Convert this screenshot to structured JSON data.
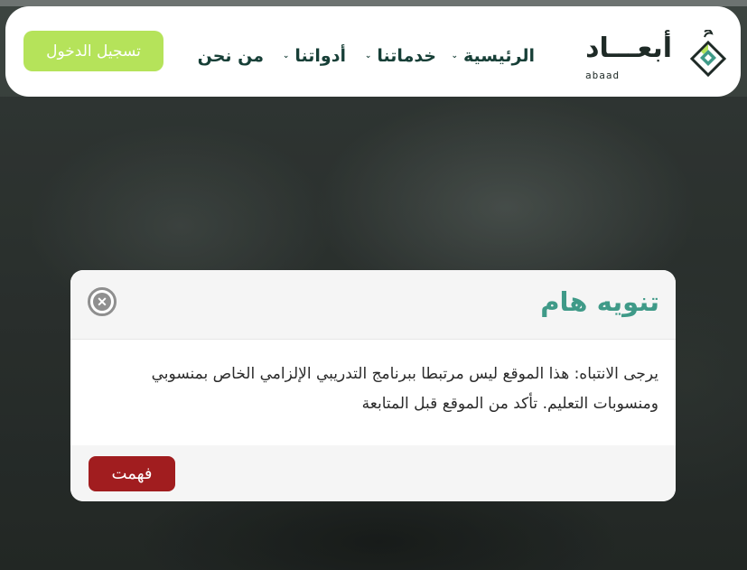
{
  "brand": {
    "name_ar": "أبعـــاد",
    "name_latin": "abaad",
    "colors": {
      "primary": "#173f37",
      "accent": "#3f9a88",
      "lime": "#b5e35a",
      "danger": "#a11d1f"
    }
  },
  "header": {
    "nav": [
      {
        "label": "الرئيسية",
        "has_dropdown": true
      },
      {
        "label": "خدماتنا",
        "has_dropdown": true
      },
      {
        "label": "أدواتنا",
        "has_dropdown": true
      },
      {
        "label": "من نحن",
        "has_dropdown": false
      }
    ],
    "dropdown_icon": "chevron-down-icon",
    "login_label": "تسجيل الدخول"
  },
  "modal": {
    "title": "تنويه هام",
    "close_icon": "close-circle-icon",
    "message": "يرجى الانتباه: هذا الموقع ليس مرتبطا ببرنامج التدريبي الإلزامي الخاص بمنسوبي ومنسوبات التعليم. تأكد من الموقع قبل المتابعة",
    "confirm_label": "فهمت"
  }
}
